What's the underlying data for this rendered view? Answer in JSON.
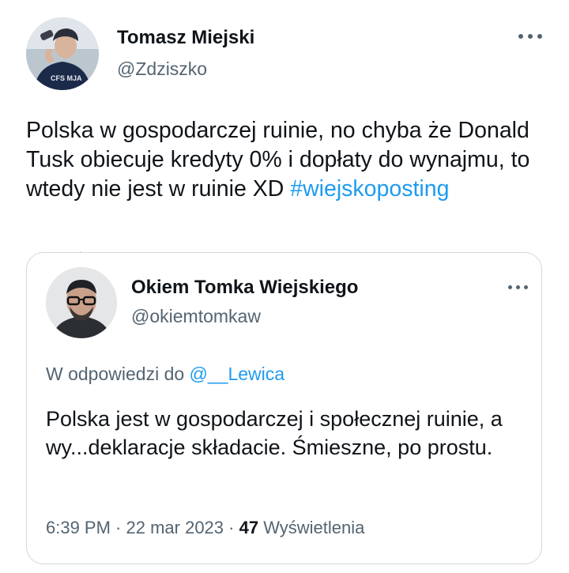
{
  "author": {
    "name": "Tomasz Miejski",
    "handle": "@Zdziszko",
    "avatar_icon": "user-avatar-photo",
    "avatar_jacket_text": "CFS MJA"
  },
  "tweet": {
    "text": "Polska w gospodarczej ruinie, no chyba że Donald Tusk obiecuje kredyty 0% i dopłaty do wynajmu, to wtedy nie jest w ruinie XD ",
    "hashtag": "#wiejskoposting"
  },
  "quoted": {
    "name": "Okiem Tomka Wiejskiego",
    "handle": "@okiemtomkaw",
    "reply_prefix": "W odpowiedzi do ",
    "reply_mention": "@__Lewica",
    "text": "Polska jest w gospodarczej i społecznej ruinie, a wy...deklaracje składacie. Śmieszne, po prostu.",
    "time": "6:39 PM",
    "separator": " · ",
    "date": "22 mar 2023",
    "views": "47",
    "views_label": " Wyświetlenia"
  },
  "colors": {
    "accent": "#1d9bf0",
    "secondary_text": "#536471",
    "border": "#cfd9de"
  }
}
